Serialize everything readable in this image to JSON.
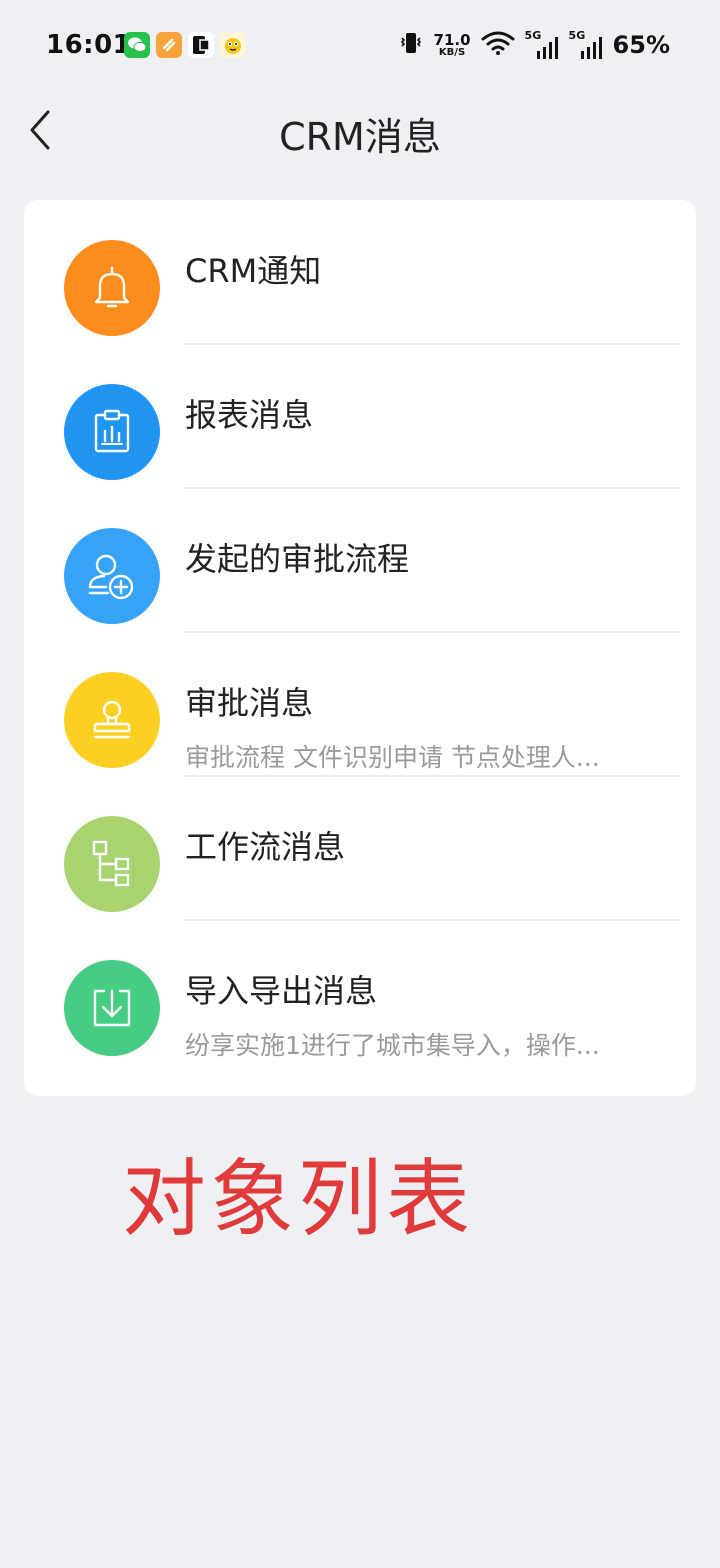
{
  "status_bar": {
    "time": "16:01",
    "net_speed_value": "71.0",
    "net_speed_unit": "KB/S",
    "signal_1_label": "5G",
    "signal_2_label": "5G",
    "battery": "65%"
  },
  "header": {
    "title": "CRM消息"
  },
  "messages": [
    {
      "title": "CRM通知",
      "subtitle": "",
      "icon": "bell-icon",
      "color": "#fb8c1e"
    },
    {
      "title": "报表消息",
      "subtitle": "",
      "icon": "report-clipboard-icon",
      "color": "#1f95f0"
    },
    {
      "title": "发起的审批流程",
      "subtitle": "",
      "icon": "user-add-icon",
      "color": "#36a3f7"
    },
    {
      "title": "审批消息",
      "subtitle": "审批流程 文件识别申请 节点处理人...",
      "icon": "stamp-icon",
      "color": "#fcd022"
    },
    {
      "title": "工作流消息",
      "subtitle": "",
      "icon": "workflow-icon",
      "color": "#a7d46e"
    },
    {
      "title": "导入导出消息",
      "subtitle": "纷享实施1进行了城市集导入，操作...",
      "icon": "import-export-icon",
      "color": "#46cc83"
    }
  ],
  "annotation": {
    "text": "对象列表",
    "color": "#e03a3a"
  }
}
